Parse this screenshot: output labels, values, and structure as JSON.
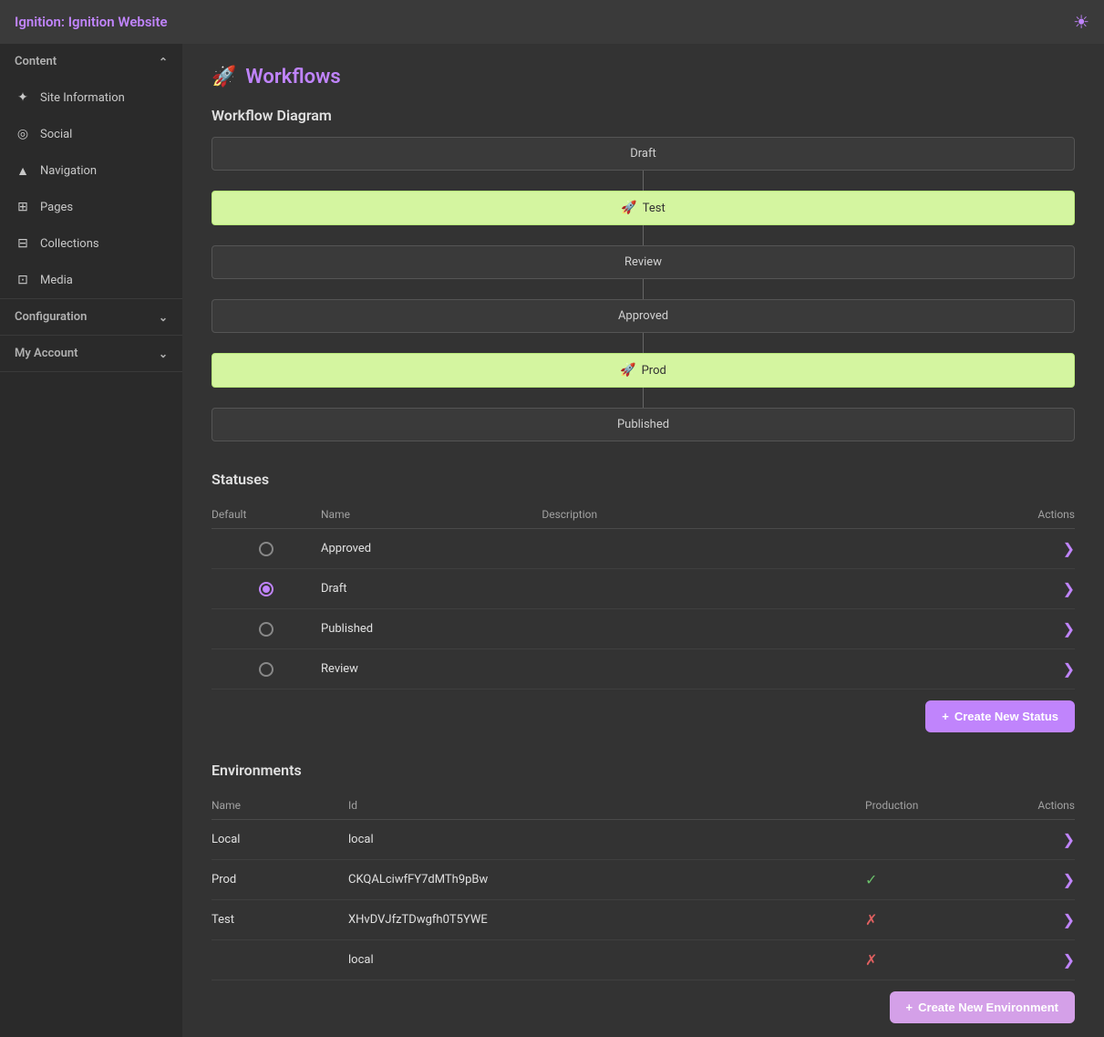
{
  "topbar": {
    "title": "Ignition: Ignition Website",
    "settings_icon": "☀"
  },
  "sidebar": {
    "content_label": "Content",
    "items": [
      {
        "id": "site-information",
        "label": "Site Information",
        "icon": "✦"
      },
      {
        "id": "social",
        "label": "Social",
        "icon": "◎"
      },
      {
        "id": "navigation",
        "label": "Navigation",
        "icon": "▲"
      },
      {
        "id": "pages",
        "label": "Pages",
        "icon": "⊞"
      },
      {
        "id": "collections",
        "label": "Collections",
        "icon": "⊟"
      },
      {
        "id": "media",
        "label": "Media",
        "icon": "⊡"
      }
    ],
    "configuration_label": "Configuration",
    "my_account_label": "My Account"
  },
  "page": {
    "icon": "🚀",
    "title": "Workflows",
    "workflow_diagram_title": "Workflow Diagram",
    "workflow_boxes": [
      {
        "label": "Draft",
        "green": false
      },
      {
        "label": "Test",
        "green": true,
        "rocket": true
      },
      {
        "label": "Review",
        "green": false
      },
      {
        "label": "Approved",
        "green": false
      },
      {
        "label": "Prod",
        "green": true,
        "rocket": true
      },
      {
        "label": "Published",
        "green": false
      }
    ],
    "statuses_title": "Statuses",
    "statuses_columns": {
      "default": "Default",
      "name": "Name",
      "description": "Description",
      "actions": "Actions"
    },
    "statuses": [
      {
        "name": "Approved",
        "selected": false
      },
      {
        "name": "Draft",
        "selected": true
      },
      {
        "name": "Published",
        "selected": false
      },
      {
        "name": "Review",
        "selected": false
      }
    ],
    "create_status_label": "Create New Status",
    "environments_title": "Environments",
    "env_columns": {
      "name": "Name",
      "id": "Id",
      "production": "Production",
      "actions": "Actions"
    },
    "environments": [
      {
        "name": "Local",
        "id": "local",
        "production": null
      },
      {
        "name": "Prod",
        "id": "CKQALciwfFY7dMTh9pBw",
        "production": true
      },
      {
        "name": "Test",
        "id": "XHvDVJfzTDwgfh0T5YWE",
        "production": false
      },
      {
        "name": "",
        "id": "local",
        "production": false
      }
    ],
    "create_environment_label": "Create New Environment"
  }
}
